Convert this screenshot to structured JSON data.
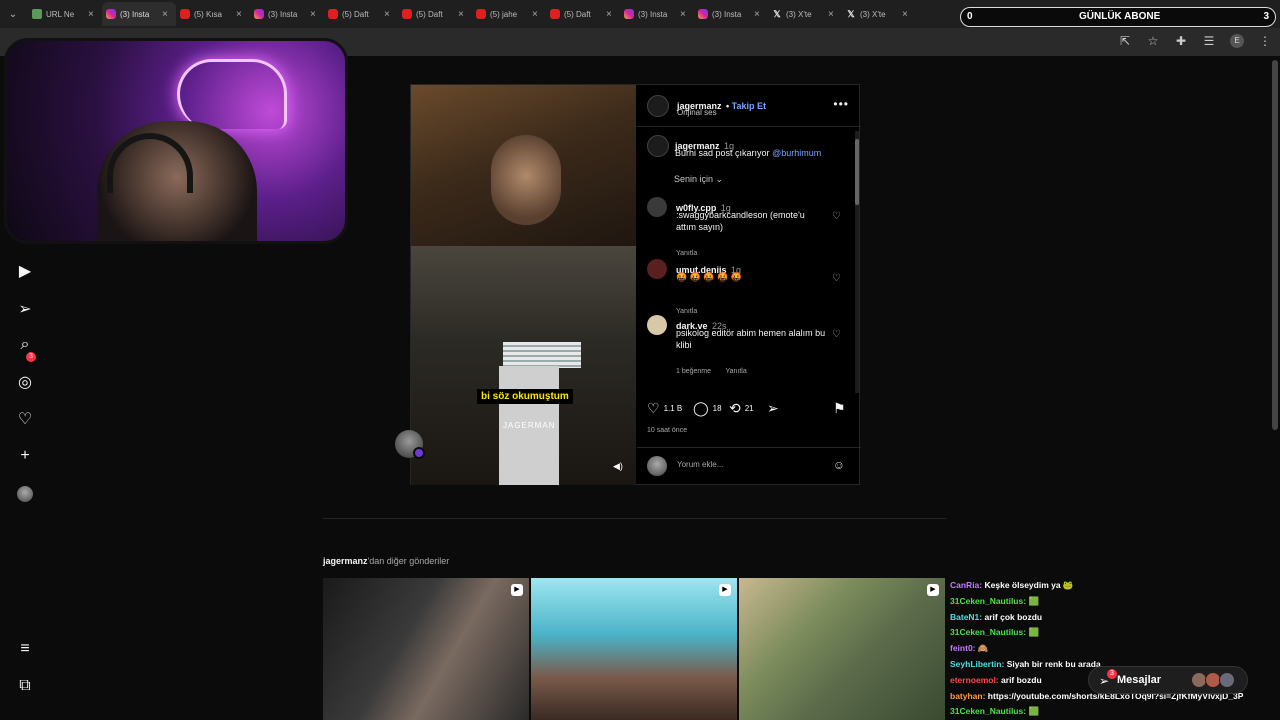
{
  "tabs": [
    {
      "title": "URL Ne",
      "icon": "sc"
    },
    {
      "title": "(3) Insta",
      "icon": "ig",
      "active": true
    },
    {
      "title": "(5) Kısa",
      "icon": "yt"
    },
    {
      "title": "(3) Insta",
      "icon": "ig"
    },
    {
      "title": "(5) Daft",
      "icon": "yt"
    },
    {
      "title": "(5) Daft",
      "icon": "yt"
    },
    {
      "title": "(5) jahe",
      "icon": "yt"
    },
    {
      "title": "(5) Daft",
      "icon": "yt"
    },
    {
      "title": "(3) Insta",
      "icon": "ig"
    },
    {
      "title": "(3) Insta",
      "icon": "ig"
    },
    {
      "title": "(3) X'te",
      "icon": "x"
    },
    {
      "title": "(3) X'te",
      "icon": "x"
    }
  ],
  "subs_overlay": {
    "left_value": "0",
    "title": "GÜNLÜK ABONE",
    "count": "3"
  },
  "nav": {
    "notifications_badge": "3"
  },
  "post": {
    "author": "jagermanz",
    "follow_label": "Takip Et",
    "audio": "Orijinal ses",
    "caption_user": "jagermanz",
    "caption_time": "1g",
    "caption_text": "Burhi sad post çıkarıyor",
    "caption_mention": "@burhimum",
    "sort_label": "Senin için",
    "comments": [
      {
        "user": "w0fly.cpp",
        "time": "1g",
        "text": ":swaggybarkcandleson (emote'u attım sayın)",
        "reply": "Yanıtla",
        "likes": ""
      },
      {
        "user": "umut.deniis",
        "time": "1g",
        "text": "🤬 🤬 🤬 🤬 🤬",
        "reply": "Yanıtla",
        "likes": ""
      },
      {
        "user": "dark.ve",
        "time": "22s",
        "text": "psikolog editör abim hemen alalım bu klibi",
        "reply": "Yanıtla",
        "likes": "1 beğenme"
      }
    ],
    "likes_count": "1.1 B",
    "comments_count": "18",
    "reposts_count": "21",
    "time_ago": "10 saat önce",
    "comment_placeholder": "Yorum ekle...",
    "video_caption": "bi söz okumuştum",
    "watermark": "JAGERMAN"
  },
  "more_posts": {
    "user": "jagermanz",
    "suffix": "'dan diğer gönderiler"
  },
  "chat": [
    {
      "user": "CanRia:",
      "user_color": "#c07aff",
      "text": "Keşke ölseydim ya 🐸"
    },
    {
      "user": "31Ceken_Nautilus:",
      "user_color": "#4ce04c",
      "text": "🟩"
    },
    {
      "user": "BateN1:",
      "user_color": "#4ce0e0",
      "text": "arif çok bozdu"
    },
    {
      "user": "31Ceken_Nautilus:",
      "user_color": "#4ce04c",
      "text": "🟩"
    },
    {
      "user": "feint0:",
      "user_color": "#c07aff",
      "text": "🙈"
    },
    {
      "user": "SeyhLibertin:",
      "user_color": "#4ce0e0",
      "text": "Siyah bir renk bu arada"
    },
    {
      "user": "eternoemol:",
      "user_color": "#ff4a4a",
      "text": "arif bozdu"
    },
    {
      "user": "batyhan:",
      "user_color": "#ff9a3a",
      "text": "https://youtube.com/shorts/kE8LxoTOq9I?si=ZjfKfMyVlvxjD_3P"
    },
    {
      "user": "31Ceken_Nautilus:",
      "user_color": "#4ce04c",
      "text": "🟩"
    }
  ],
  "messages": {
    "label": "Mesajlar",
    "badge": "3"
  }
}
